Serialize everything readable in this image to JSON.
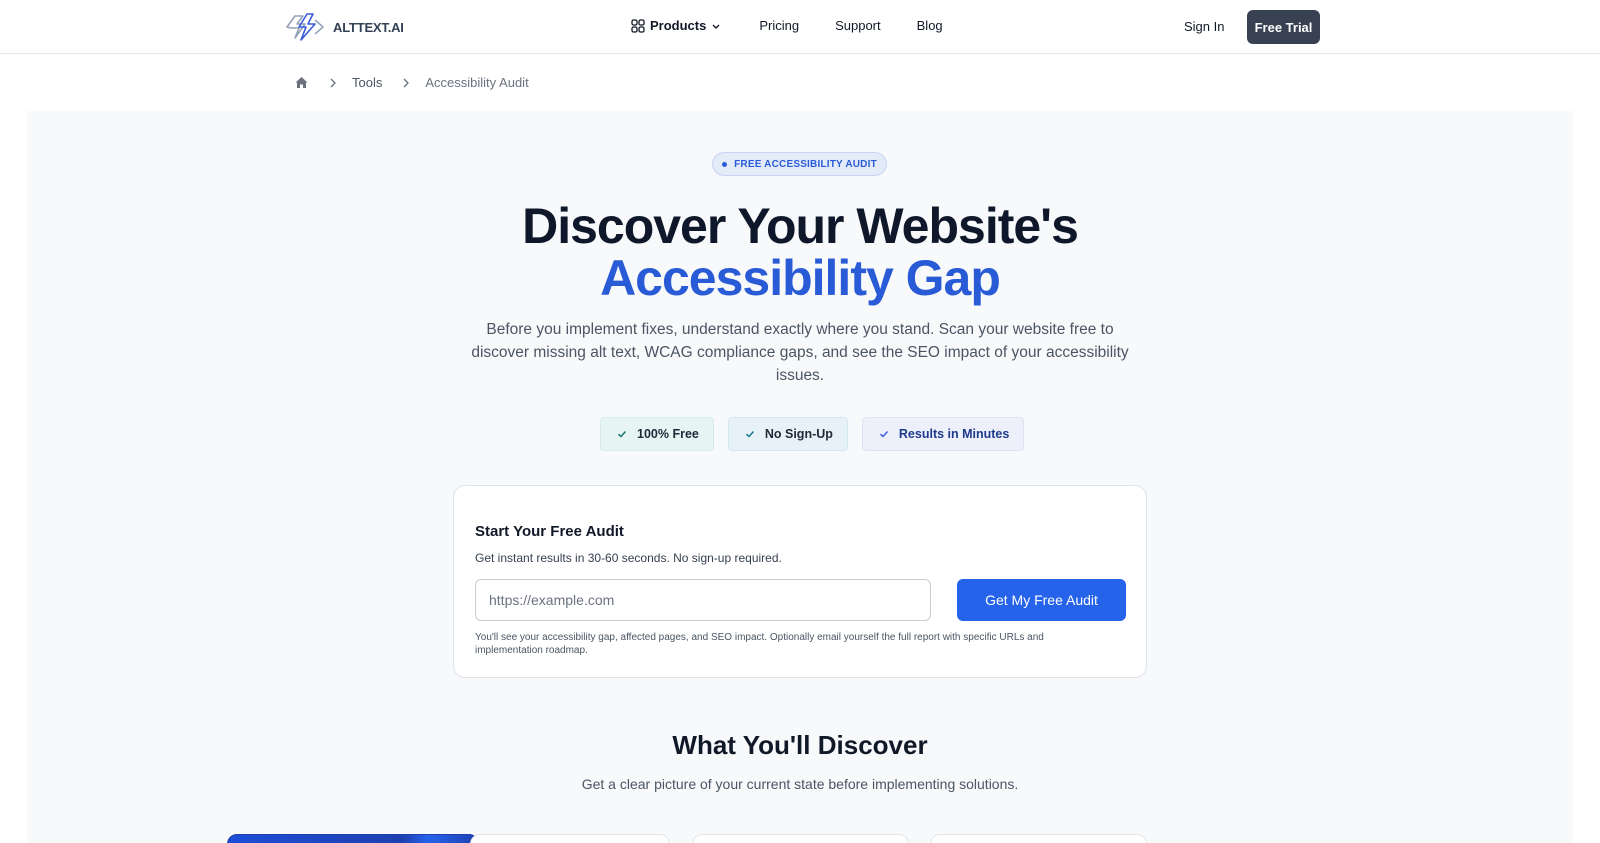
{
  "header": {
    "logo_text": "ALTTEXT.AI",
    "nav": [
      {
        "label": "Products",
        "icon": "grid-icon",
        "dropdown": true
      },
      {
        "label": "Pricing"
      },
      {
        "label": "Support"
      },
      {
        "label": "Blog"
      }
    ],
    "sign_in": "Sign In",
    "free_trial": "Free Trial"
  },
  "breadcrumb": {
    "home_icon": "home-icon",
    "items": [
      "Tools",
      "Accessibility Audit"
    ]
  },
  "hero": {
    "badge": "FREE ACCESSIBILITY AUDIT",
    "title_line1": "Discover Your Website's",
    "title_line2": "Accessibility Gap",
    "lead": "Before you implement fixes, understand exactly where you stand. Scan your website free to discover missing alt text, WCAG compliance gaps, and see the SEO impact of your accessibility issues.",
    "pills": [
      "100% Free",
      "No Sign-Up",
      "Results in Minutes"
    ]
  },
  "audit": {
    "title": "Start Your Free Audit",
    "subtitle": "Get instant results in 30-60 seconds. No sign-up required.",
    "placeholder": "https://example.com",
    "button": "Get My Free Audit",
    "note": "You'll see your accessibility gap, affected pages, and SEO impact. Optionally email yourself the full report with specific URLs and implementation roadmap."
  },
  "discover": {
    "title": "What You'll Discover",
    "subtitle": "Get a clear picture of your current state before implementing solutions."
  },
  "colors": {
    "accent": "#2a5bd7",
    "button": "#2563eb",
    "trial_button": "#374151"
  }
}
